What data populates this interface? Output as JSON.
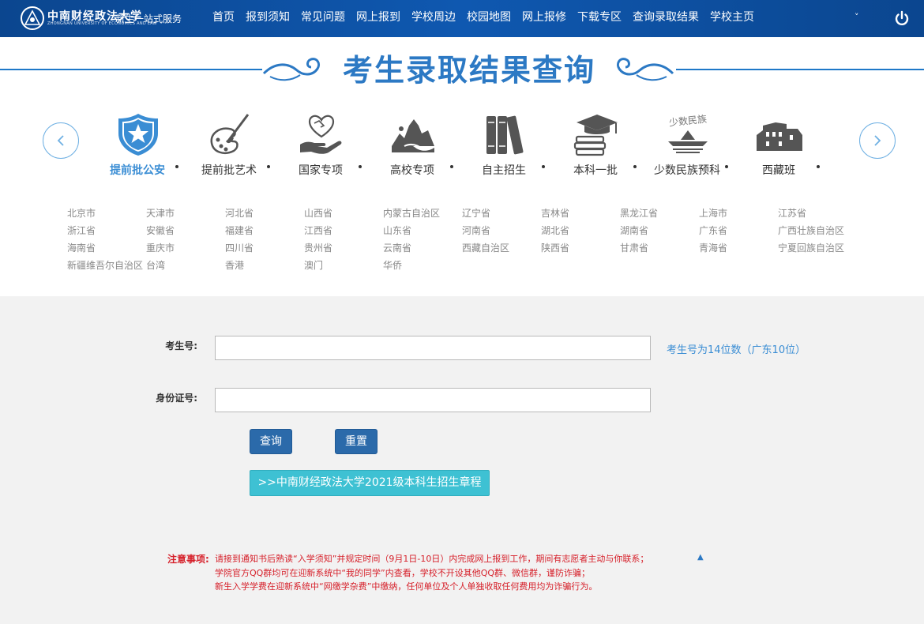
{
  "header": {
    "brand": "中南财经政法大学",
    "brand_sub": "ZHONGNAN UNIVERSITY OF ECONOMICS AND LAW",
    "service": "新生一站式服务",
    "nav": [
      "首页",
      "报到须知",
      "常见问题",
      "网上报到",
      "学校周边",
      "校园地图",
      "网上报修",
      "下载专区",
      "查询录取结果",
      "学校主页"
    ],
    "dropdown": "˅",
    "bg_color": "#0d4fa0"
  },
  "page_title": "考生录取结果查询",
  "categories": [
    {
      "label": "提前批公安",
      "icon": "police-badge-icon",
      "active": true
    },
    {
      "label": "提前批艺术",
      "icon": "art-palette-icon",
      "active": false
    },
    {
      "label": "国家专项",
      "icon": "handshake-heart-icon",
      "active": false
    },
    {
      "label": "高校专项",
      "icon": "landscape-icon",
      "active": false
    },
    {
      "label": "自主招生",
      "icon": "books-icon",
      "active": false
    },
    {
      "label": "本科一批",
      "icon": "graduation-cap-icon",
      "active": false
    },
    {
      "label": "少数民族预科",
      "icon": "ethnic-hat-icon",
      "active": false
    },
    {
      "label": "西藏班",
      "icon": "potala-palace-icon",
      "active": false
    }
  ],
  "ethnic_icon_text": "少数民族",
  "provinces": [
    [
      "北京市",
      "天津市",
      "河北省",
      "山西省",
      "内蒙古自治区",
      "辽宁省",
      "吉林省",
      "黑龙江省",
      "上海市",
      "江苏省"
    ],
    [
      "浙江省",
      "安徽省",
      "福建省",
      "江西省",
      "山东省",
      "河南省",
      "湖北省",
      "湖南省",
      "广东省",
      "广西壮族自治区"
    ],
    [
      "海南省",
      "重庆市",
      "四川省",
      "贵州省",
      "云南省",
      "西藏自治区",
      "陕西省",
      "甘肃省",
      "青海省",
      "宁夏回族自治区"
    ],
    [
      "新疆维吾尔自治区",
      "台湾",
      "香港",
      "澳门",
      "华侨"
    ]
  ],
  "form": {
    "exam_no_label": "考生号:",
    "exam_no_value": "",
    "exam_no_hint": "考生号为14位数（广东10位）",
    "id_label": "身份证号:",
    "id_value": "",
    "query_button": "查询",
    "reset_button": "重置",
    "rules_button": ">>中南财经政法大学2021级本科生招生章程"
  },
  "notice": {
    "label": "注意事项:",
    "lines": [
      "请接到通知书后熟读“入学须知”并规定时间（9月1日-10日）内完成网上报到工作，期间有志愿者主动与你联系；",
      "学院官方QQ群均可在迎新系统中“我的同学”内查看，学校不开设其他QQ群、微信群，谨防诈骗；",
      "新生入学学费在迎新系统中“网缴学杂费”中缴纳，任何单位及个人单独收取任何费用均为诈骗行为。"
    ],
    "up_icon": "▲"
  },
  "colors": {
    "accent": "#2c79c4",
    "active_category": "#3a8dd4",
    "notice": "#d6202a",
    "button": "#2b6aaa",
    "rules_button": "#3ec1d3"
  }
}
